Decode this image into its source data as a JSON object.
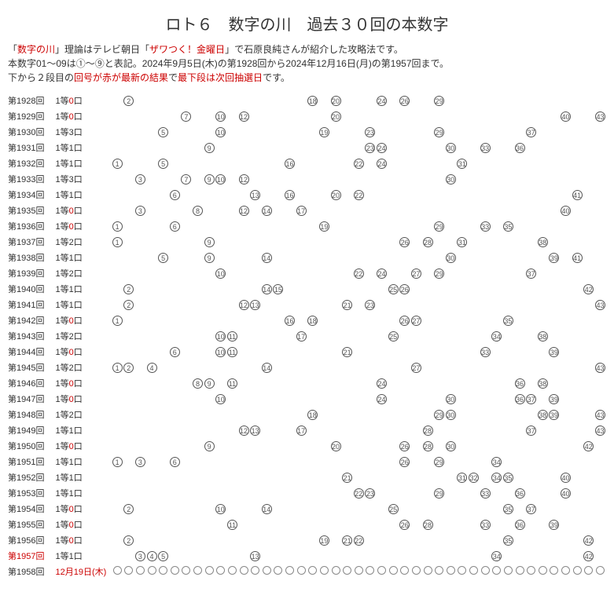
{
  "title": "ロト６　数字の川　過去３０回の本数字",
  "intro": {
    "p1a": "「",
    "p1b": "数字の川",
    "p1c": "」理論はテレビ朝日「",
    "p1d": "ザワつく！金曜日",
    "p1e": "」で石原良純さんが紹介した攻略法です。",
    "p2": "本数字01～09は①～⑨と表記。2024年9月5日(木)の第1928回から2024年12月16日(月)の第1957回まで。",
    "p3a": "下から２段目の",
    "p3b": "回号が赤が最新の結果",
    "p3c": "で",
    "p3d": "最下段は次回抽選日",
    "p3e": "です。"
  },
  "next": {
    "round": "第1958回",
    "date": "12月19日(木)"
  },
  "chart_data": {
    "type": "table",
    "title": "ロト６ 数字の川 過去３０回の本数字",
    "columns_range": [
      1,
      43
    ],
    "rows": [
      {
        "round": "第1928回",
        "prize": "1等",
        "count": 0,
        "nums": [
          2,
          18,
          20,
          24,
          26,
          29
        ]
      },
      {
        "round": "第1929回",
        "prize": "1等",
        "count": 0,
        "nums": [
          7,
          10,
          12,
          20,
          40,
          43
        ]
      },
      {
        "round": "第1930回",
        "prize": "1等",
        "count": 3,
        "nums": [
          5,
          10,
          19,
          23,
          29,
          37
        ]
      },
      {
        "round": "第1931回",
        "prize": "1等",
        "count": 1,
        "nums": [
          9,
          23,
          24,
          30,
          33,
          36
        ]
      },
      {
        "round": "第1932回",
        "prize": "1等",
        "count": 1,
        "nums": [
          1,
          5,
          16,
          22,
          24,
          31
        ]
      },
      {
        "round": "第1933回",
        "prize": "1等",
        "count": 3,
        "nums": [
          3,
          7,
          9,
          10,
          12,
          30
        ]
      },
      {
        "round": "第1934回",
        "prize": "1等",
        "count": 1,
        "nums": [
          6,
          13,
          16,
          20,
          22,
          41
        ]
      },
      {
        "round": "第1935回",
        "prize": "1等",
        "count": 0,
        "nums": [
          3,
          8,
          12,
          14,
          17,
          40
        ]
      },
      {
        "round": "第1936回",
        "prize": "1等",
        "count": 0,
        "nums": [
          1,
          6,
          19,
          29,
          33,
          35
        ]
      },
      {
        "round": "第1937回",
        "prize": "1等",
        "count": 2,
        "nums": [
          1,
          9,
          26,
          28,
          31,
          38
        ]
      },
      {
        "round": "第1938回",
        "prize": "1等",
        "count": 1,
        "nums": [
          5,
          9,
          14,
          30,
          39,
          41
        ]
      },
      {
        "round": "第1939回",
        "prize": "1等",
        "count": 2,
        "nums": [
          10,
          22,
          24,
          27,
          29,
          37
        ]
      },
      {
        "round": "第1940回",
        "prize": "1等",
        "count": 1,
        "nums": [
          2,
          14,
          15,
          25,
          26,
          42
        ]
      },
      {
        "round": "第1941回",
        "prize": "1等",
        "count": 1,
        "nums": [
          2,
          12,
          13,
          21,
          23,
          43
        ]
      },
      {
        "round": "第1942回",
        "prize": "1等",
        "count": 0,
        "nums": [
          1,
          16,
          18,
          26,
          27,
          35
        ]
      },
      {
        "round": "第1943回",
        "prize": "1等",
        "count": 2,
        "nums": [
          10,
          11,
          17,
          25,
          34,
          38
        ]
      },
      {
        "round": "第1944回",
        "prize": "1等",
        "count": 0,
        "nums": [
          6,
          10,
          11,
          21,
          33,
          39
        ]
      },
      {
        "round": "第1945回",
        "prize": "1等",
        "count": 2,
        "nums": [
          1,
          2,
          4,
          14,
          27,
          43
        ]
      },
      {
        "round": "第1946回",
        "prize": "1等",
        "count": 0,
        "nums": [
          8,
          9,
          11,
          24,
          36,
          38
        ]
      },
      {
        "round": "第1947回",
        "prize": "1等",
        "count": 0,
        "nums": [
          10,
          24,
          30,
          36,
          37,
          39
        ]
      },
      {
        "round": "第1948回",
        "prize": "1等",
        "count": 2,
        "nums": [
          18,
          29,
          30,
          38,
          39,
          43
        ]
      },
      {
        "round": "第1949回",
        "prize": "1等",
        "count": 1,
        "nums": [
          12,
          13,
          17,
          28,
          37,
          43
        ]
      },
      {
        "round": "第1950回",
        "prize": "1等",
        "count": 0,
        "nums": [
          9,
          20,
          26,
          28,
          30,
          42
        ]
      },
      {
        "round": "第1951回",
        "prize": "1等",
        "count": 1,
        "nums": [
          1,
          3,
          6,
          26,
          29,
          34
        ]
      },
      {
        "round": "第1952回",
        "prize": "1等",
        "count": 1,
        "nums": [
          21,
          31,
          32,
          34,
          35,
          40
        ]
      },
      {
        "round": "第1953回",
        "prize": "1等",
        "count": 1,
        "nums": [
          22,
          23,
          29,
          33,
          36,
          40
        ]
      },
      {
        "round": "第1954回",
        "prize": "1等",
        "count": 0,
        "nums": [
          2,
          10,
          14,
          25,
          35,
          37
        ]
      },
      {
        "round": "第1955回",
        "prize": "1等",
        "count": 0,
        "nums": [
          11,
          26,
          28,
          33,
          36,
          39
        ]
      },
      {
        "round": "第1956回",
        "prize": "1等",
        "count": 0,
        "nums": [
          2,
          19,
          21,
          22,
          35,
          42
        ]
      },
      {
        "round": "第1957回",
        "prize": "1等",
        "count": 1,
        "nums": [
          3,
          4,
          5,
          13,
          34,
          42
        ],
        "latest": true
      }
    ]
  }
}
